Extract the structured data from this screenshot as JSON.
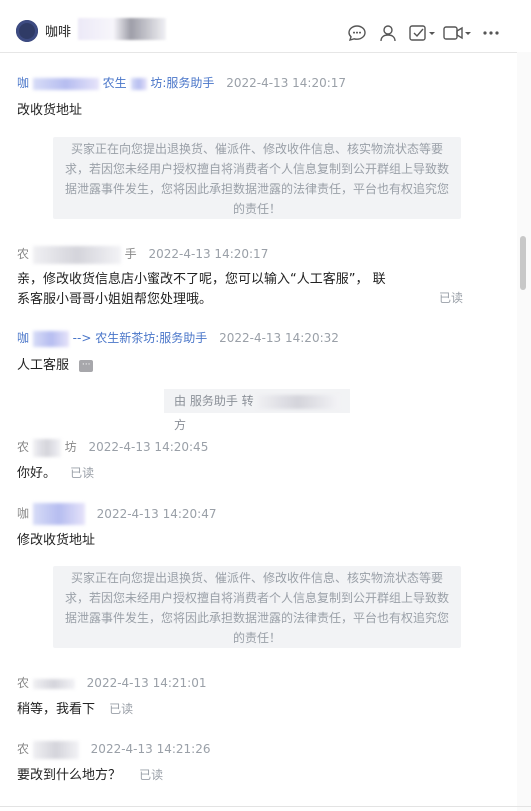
{
  "header": {
    "title": "咖啡",
    "icons": [
      "chat-bubble-icon",
      "user-icon",
      "task-check-icon",
      "video-icon",
      "more-icon"
    ]
  },
  "messages": [
    {
      "sender": "咖",
      "sender_suffix": "农生",
      "role": "坊:服务助手",
      "time": "2022-4-13 14:20:17",
      "text": "改收货地址"
    },
    {
      "notice": "买家正在向您提出退换货、催派件、修改收件信息、核实物流状态等要求，若因您未经用户授权擅自将消费者个人信息复制到公开群组上导致数据泄露事件发生，您将因此承担数据泄露的法律责任，平台也有权追究您的责任！"
    },
    {
      "sender": "农",
      "role": "手",
      "time": "2022-4-13 14:20:17",
      "text_line1": "亲，修改收货信息店小蜜改不了呢，您可以输入“人工客服”， 联",
      "text_line2": "系客服小哥哥小姐姐帮您处理哦。",
      "read": "已读"
    },
    {
      "sender": "咖",
      "arrow": "--> 农生新茶坊:服务助手",
      "time": "2022-4-13 14:20:32",
      "text": "人工客服",
      "more": "···"
    },
    {
      "system": "由 服务助手 转",
      "system_end": "方"
    },
    {
      "sender": "农",
      "role": "坊",
      "time": "2022-4-13 14:20:45",
      "text": "你好。",
      "read": "已读"
    },
    {
      "sender": "咖",
      "time": "2022-4-13 14:20:47",
      "text": "修改收货地址"
    },
    {
      "notice": "买家正在向您提出退换货、催派件、修改收件信息、核实物流状态等要求，若因您未经用户授权擅自将消费者个人信息复制到公开群组上导致数据泄露事件发生，您将因此承担数据泄露的法律责任，平台也有权追究您的责任！"
    },
    {
      "sender": "农",
      "time": "2022-4-13 14:21:01",
      "text": "稍等，我看下",
      "read": "已读"
    },
    {
      "sender": "农",
      "time": "2022-4-13 14:21:26",
      "text": "要改到什么地方？",
      "read": "已读"
    }
  ]
}
